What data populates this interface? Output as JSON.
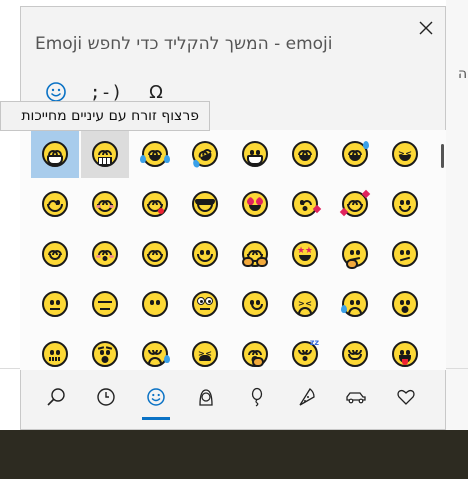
{
  "background": {
    "side_text": "ה"
  },
  "panel": {
    "search_text": "Emoji המשך להקליד כדי לחפש - emoji",
    "close_label": "Close",
    "tooltip": "פרצוף זורח עם עיניים מחייכות",
    "top_tabs": [
      {
        "name": "emoji",
        "icon": "smiley-icon",
        "label": ""
      },
      {
        "name": "kaomoji",
        "icon": "kaomoji-icon",
        "label": ";-)"
      },
      {
        "name": "symbols",
        "icon": "omega-icon",
        "label": "Ω"
      }
    ],
    "selected_top_tab": "emoji"
  },
  "emoji_grid": [
    [
      "grinning-smiling-eyes",
      "grimacing",
      "joy",
      "rolling-laughing",
      "grinning",
      "smile",
      "sweat-smile",
      "laughing"
    ],
    [
      "wink",
      "blush",
      "yum",
      "sunglasses",
      "heart-eyes",
      "kissing-heart",
      "smiling-hearts",
      "slight-smile"
    ],
    [
      "relaxed",
      "kissing-blush",
      "smiling-eyes",
      "hugging",
      "hugging-hands",
      "star-struck",
      "thinking",
      "confused"
    ],
    [
      "neutral",
      "expressionless",
      "no-mouth",
      "rolling-eyes",
      "smirk",
      "persevering",
      "disappointed-relieved",
      "open-mouth"
    ],
    [
      "zipper-mouth",
      "hushed",
      "sleepy",
      "tired",
      "yawning",
      "sleeping",
      "relieved",
      "tongue-out"
    ]
  ],
  "bottom_tabs": [
    {
      "name": "search",
      "icon": "search-icon"
    },
    {
      "name": "recent",
      "icon": "clock-icon"
    },
    {
      "name": "smileys",
      "icon": "smiley-icon"
    },
    {
      "name": "people",
      "icon": "person-icon"
    },
    {
      "name": "celebrations",
      "icon": "balloon-icon"
    },
    {
      "name": "food",
      "icon": "pizza-icon"
    },
    {
      "name": "travel",
      "icon": "car-icon"
    },
    {
      "name": "symbols",
      "icon": "heart-icon"
    }
  ],
  "selected_bottom_tab": "smileys",
  "colors": {
    "accent": "#0a72c5",
    "selected_cell": "#a8ccec",
    "emoji_yellow": "#fcd836"
  }
}
